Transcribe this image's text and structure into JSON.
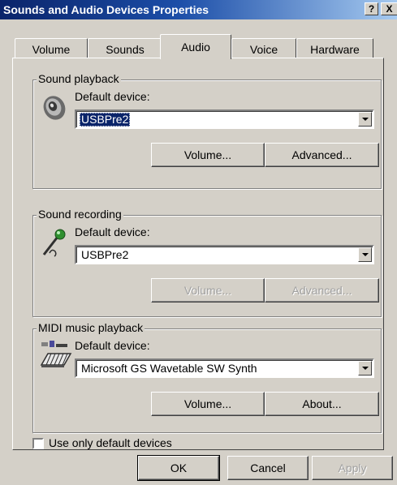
{
  "window": {
    "title": "Sounds and Audio Devices Properties",
    "help_label": "?",
    "close_label": "X"
  },
  "tabs": [
    {
      "label": "Volume",
      "active": false
    },
    {
      "label": "Sounds",
      "active": false
    },
    {
      "label": "Audio",
      "active": true
    },
    {
      "label": "Voice",
      "active": false
    },
    {
      "label": "Hardware",
      "active": false
    }
  ],
  "sound_playback": {
    "group_label": "Sound playback",
    "device_label": "Default device:",
    "device_value": "USBPre2",
    "volume_button": "Volume...",
    "advanced_button": "Advanced...",
    "icon": "speaker-icon"
  },
  "sound_recording": {
    "group_label": "Sound recording",
    "device_label": "Default device:",
    "device_value": "USBPre2",
    "volume_button": "Volume...",
    "advanced_button": "Advanced...",
    "buttons_disabled": true,
    "icon": "microphone-icon"
  },
  "midi_playback": {
    "group_label": "MIDI music playback",
    "device_label": "Default device:",
    "device_value": "Microsoft GS Wavetable SW Synth",
    "volume_button": "Volume...",
    "about_button": "About...",
    "icon": "midi-keyboard-icon"
  },
  "use_default_devices": {
    "label": "Use only default devices",
    "checked": false
  },
  "footer": {
    "ok_label": "OK",
    "cancel_label": "Cancel",
    "apply_label": "Apply"
  },
  "colors": {
    "titlebar_start": "#0a246a",
    "titlebar_end": "#a6caf0",
    "dialog_face": "#d4d0c8",
    "selection": "#0a246a"
  }
}
